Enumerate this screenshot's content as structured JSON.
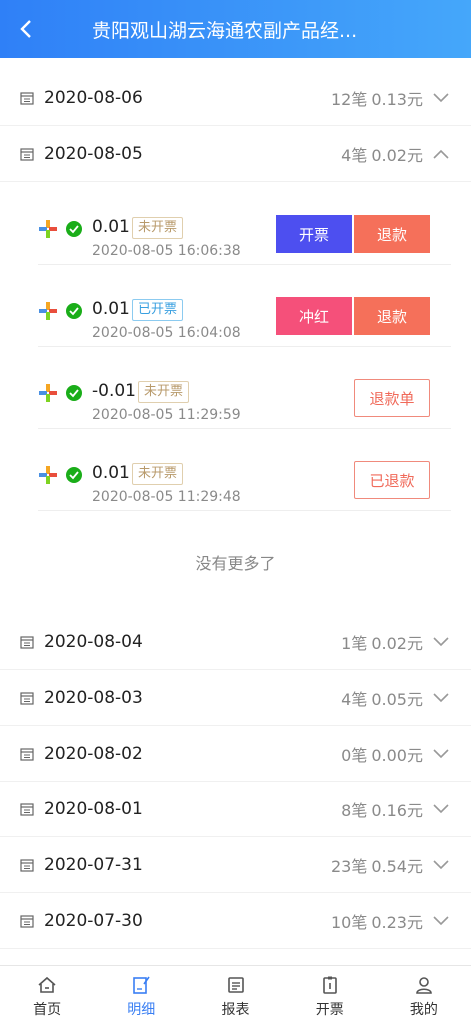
{
  "header": {
    "title": "贵阳观山湖云海通农副产品经..."
  },
  "days_top": [
    {
      "date": "2020-08-06",
      "count": "12笔",
      "amount": "0.13元",
      "expanded": false
    },
    {
      "date": "2020-08-05",
      "count": "4笔",
      "amount": "0.02元",
      "expanded": true
    }
  ],
  "transactions": [
    {
      "amount": "0.01",
      "status": "未开票",
      "time": "2020-08-05 16:06:38",
      "buttons": [
        "开票",
        "退款"
      ]
    },
    {
      "amount": "0.01",
      "status": "已开票",
      "time": "2020-08-05 16:04:08",
      "buttons": [
        "冲红",
        "退款"
      ]
    },
    {
      "amount": "-0.01",
      "status": "未开票",
      "time": "2020-08-05 11:29:59",
      "buttons": [
        "退款单"
      ]
    },
    {
      "amount": "0.01",
      "status": "未开票",
      "time": "2020-08-05 11:29:48",
      "buttons": [
        "已退款"
      ]
    }
  ],
  "no_more_text": "没有更多了",
  "days_bottom": [
    {
      "date": "2020-08-04",
      "count": "1笔",
      "amount": "0.02元"
    },
    {
      "date": "2020-08-03",
      "count": "4笔",
      "amount": "0.05元"
    },
    {
      "date": "2020-08-02",
      "count": "0笔",
      "amount": "0.00元"
    },
    {
      "date": "2020-08-01",
      "count": "8笔",
      "amount": "0.16元"
    },
    {
      "date": "2020-07-31",
      "count": "23笔",
      "amount": "0.54元"
    },
    {
      "date": "2020-07-30",
      "count": "10笔",
      "amount": "0.23元"
    }
  ],
  "tabbar": [
    {
      "label": "首页",
      "icon": "home-icon",
      "active": false
    },
    {
      "label": "明细",
      "icon": "detail-icon",
      "active": true
    },
    {
      "label": "报表",
      "icon": "report-icon",
      "active": false
    },
    {
      "label": "开票",
      "icon": "invoice-icon",
      "active": false
    },
    {
      "label": "我的",
      "icon": "user-icon",
      "active": false
    }
  ],
  "colors": {
    "header_start": "#2f80f7",
    "header_end": "#45a7fa",
    "tab_active": "#3a7ff3",
    "btn_issue": "#4d4ff0",
    "btn_refund": "#f5705a",
    "btn_reverse": "#f5507a"
  }
}
